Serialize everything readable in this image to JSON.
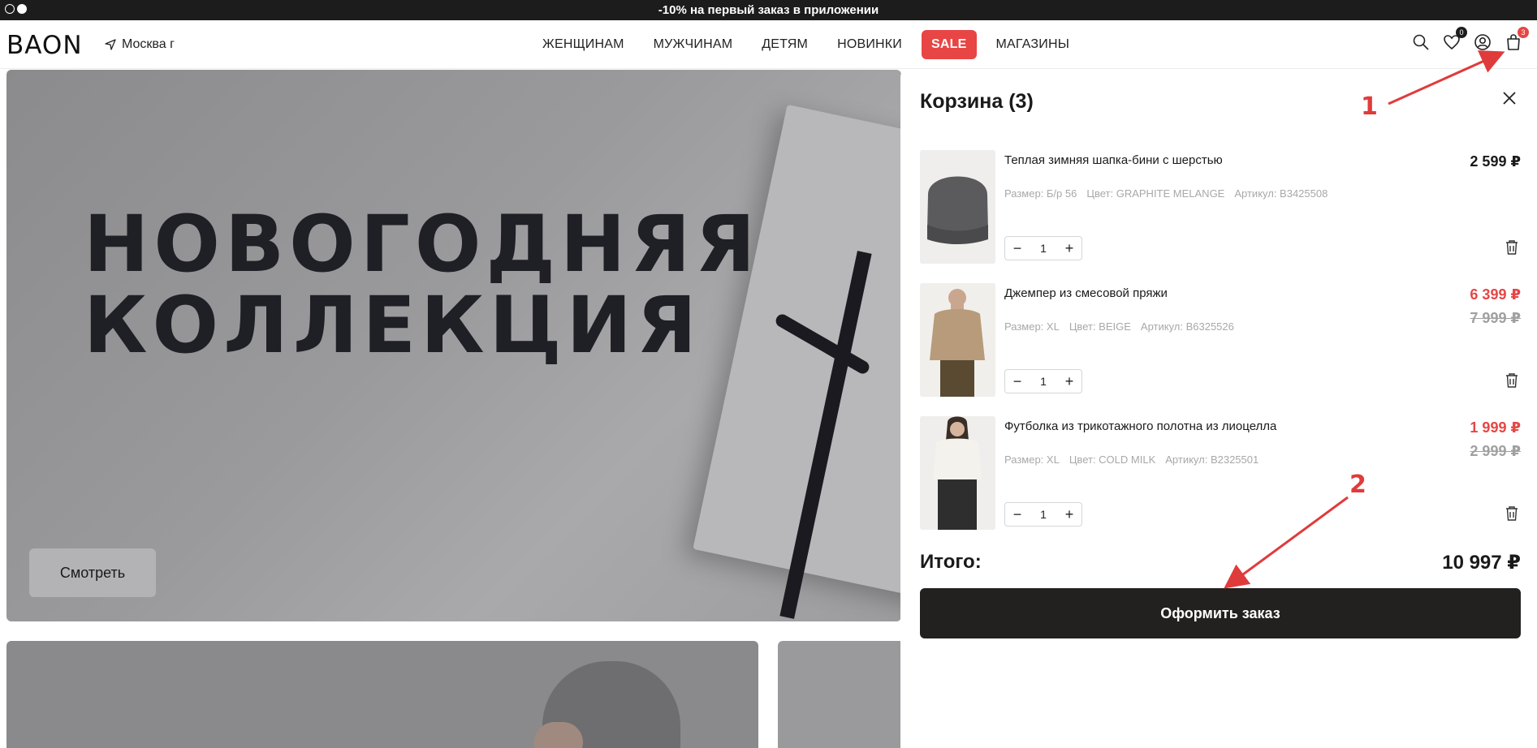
{
  "promo": {
    "text": "-10% на первый заказ в приложении"
  },
  "header": {
    "logo": "BAON",
    "city": "Москва г",
    "nav": [
      "ЖЕНЩИНАМ",
      "МУЖЧИНАМ",
      "ДЕТЯМ",
      "НОВИНКИ",
      "SALE",
      "МАГАЗИНЫ"
    ],
    "favorites_count": "0",
    "cart_count": "3"
  },
  "hero": {
    "title_line1": "НОВОГОДНЯЯ",
    "title_line2": "КОЛЛЕКЦИЯ",
    "button": "Смотреть"
  },
  "cart": {
    "title": "Корзина (3)",
    "items": [
      {
        "name": "Теплая зимняя шапка-бини с шерстью",
        "size": "Размер: Б/р 56",
        "color": "Цвет: GRAPHITE MELANGE",
        "article": "Артикул: B3425508",
        "price": "2 599 ₽",
        "old_price": "",
        "qty": "1"
      },
      {
        "name": "Джемпер из смесовой пряжи",
        "size": "Размер: XL",
        "color": "Цвет: BEIGE",
        "article": "Артикул: B6325526",
        "price": "6 399 ₽",
        "old_price": "7 999 ₽",
        "qty": "1"
      },
      {
        "name": "Футболка из трикотажного полотна из лиоцелла",
        "size": "Размер: XL",
        "color": "Цвет: COLD MILK",
        "article": "Артикул: B2325501",
        "price": "1 999 ₽",
        "old_price": "2 999 ₽",
        "qty": "1"
      }
    ],
    "total_label": "Итого:",
    "total_value": "10 997 ₽",
    "checkout": "Оформить заказ"
  },
  "annotations": {
    "n1": "1",
    "n2": "2",
    "color": "#e03b3b"
  },
  "colors": {
    "sale": "#e84545",
    "dark": "#232120"
  }
}
